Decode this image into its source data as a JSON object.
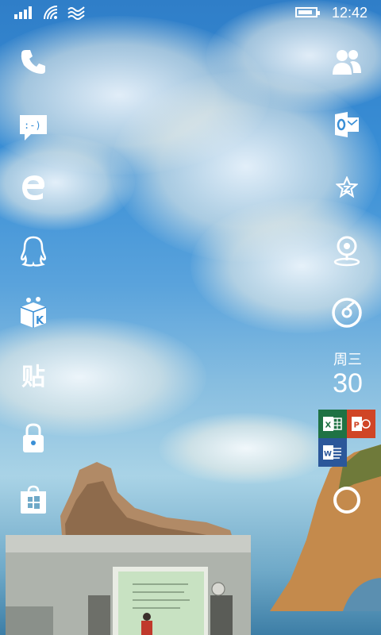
{
  "status_bar": {
    "time": "12:42",
    "icons": [
      "signal-icon",
      "wifi-icon",
      "nfc-icon",
      "battery-icon"
    ]
  },
  "left_tiles": [
    {
      "name": "phone-icon"
    },
    {
      "name": "messaging-icon"
    },
    {
      "name": "edge-browser-icon"
    },
    {
      "name": "qq-icon"
    },
    {
      "name": "kugou-music-icon"
    },
    {
      "name": "tieba-app-icon",
      "glyph": "贴"
    },
    {
      "name": "lock-icon"
    },
    {
      "name": "store-icon"
    }
  ],
  "right_tiles": [
    {
      "name": "people-icon"
    },
    {
      "name": "outlook-icon"
    },
    {
      "name": "star-app-icon"
    },
    {
      "name": "maps-icon"
    },
    {
      "name": "groove-music-icon"
    }
  ],
  "calendar": {
    "weekday": "周三",
    "date": "30"
  },
  "office": {
    "excel_letter": "X",
    "powerpoint_letter": "P",
    "word_letter": "W",
    "colors": {
      "excel": "#1f7244",
      "powerpoint": "#d04526",
      "word": "#2b579a"
    }
  },
  "cortana": {
    "name": "cortana-icon"
  }
}
